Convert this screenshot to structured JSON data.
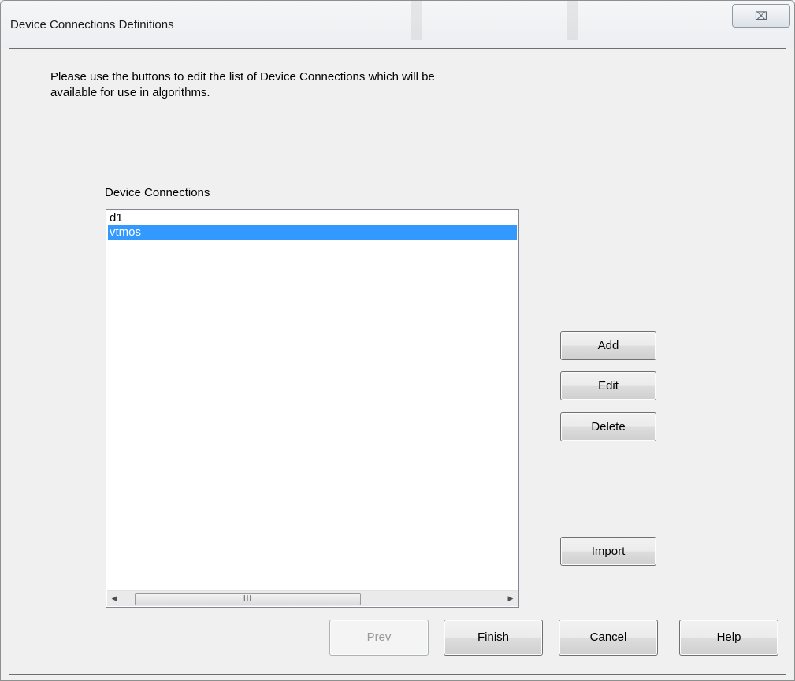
{
  "window": {
    "title": "Device Connections Definitions",
    "close_glyph": "⌧"
  },
  "instructions": {
    "line1": "Please use the buttons to edit the list of Device Connections which will be",
    "line2": "available for use in algorithms."
  },
  "device_connections": {
    "label": "Device Connections",
    "items": [
      {
        "label": "d1",
        "selected": false
      },
      {
        "label": "vtmos",
        "selected": true
      }
    ],
    "scrollbar": {
      "left_arrow": "◀",
      "right_arrow": "▶",
      "thumb_grip": "III"
    }
  },
  "side_buttons": {
    "add": "Add",
    "edit": "Edit",
    "delete": "Delete",
    "import": "Import"
  },
  "bottom_buttons": {
    "prev": "Prev",
    "finish": "Finish",
    "cancel": "Cancel",
    "help": "Help"
  },
  "colors": {
    "selection": "#3399ff",
    "background": "#f0f0f0"
  }
}
